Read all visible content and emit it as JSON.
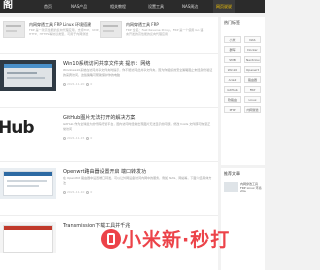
{
  "nav": {
    "logo": "阁",
    "items": [
      "首页",
      "NAS产品",
      "相关教程",
      "设置工具",
      "NAS周边",
      "网页说说"
    ],
    "active_index": 5
  },
  "top_posts": [
    {
      "title": "内网穿透工具 FRP Linux 环境搭建",
      "desc": "FRP 是一款高性能的反向代理应用，支持TCP、UDP、HTTP、HTTPS等协议类型，可用于内网穿透"
    },
    {
      "title": "内网穿透工具 FRP",
      "desc": "FRP 全名：Fast Reverse Proxy。FRP 是一个使用 Go 语言开发的高性能的反向代理应用"
    }
  ],
  "posts": [
    {
      "title": "Win10系统访问共享文件夹 提示：网络",
      "desc": "Windows10系统在访问共享文件夹时提示，你不能访问此共享文件夹，因为你组织的安全策略阻止未经身份验证的来宾访问，这些策略可帮助保护你的电脑",
      "date": "2021-11-20",
      "views": "0"
    },
    {
      "title": "GitHub图片无法打开的解决方案",
      "desc": "GitHub 作为全球最大的代码托管平台，国内访问时经常出现图片无法显示的问题，修改 hosts 文件即可恢复正常访问",
      "date": "2021-11-15",
      "views": "0"
    },
    {
      "title": "Openwrt路由器设置开启 端口转发功",
      "desc": "在 OpenWrt 路由器中设置端口转发，可以让外网设备访问内网中的服务，例如 NAS、网站等，下面介绍具体方法",
      "date": "2021-11-10",
      "views": "0"
    },
    {
      "title": "Transmission下载工具并千兆",
      "desc": "",
      "date": "",
      "views": ""
    }
  ],
  "sidebar": {
    "tags_title": "热门标签",
    "tags": [
      "小米",
      "NAS",
      "群晖",
      "Docker",
      "SMB",
      "Nextcloud",
      "Win10",
      "Openwrt",
      "Aria2",
      "路由器",
      "GitHub",
      "FRP",
      "软路由",
      "Linux",
      "PHP",
      "内网穿透"
    ],
    "recent_title": "推荐文章",
    "recent_item": "内网穿透工具 FRP Linux 环境搭建"
  },
  "watermark": {
    "text": "小米新·秒打"
  },
  "colors": {
    "nav_bg": "#2b2b2b",
    "active_nav": "#ffcc00",
    "watermark": "#e9232a"
  }
}
